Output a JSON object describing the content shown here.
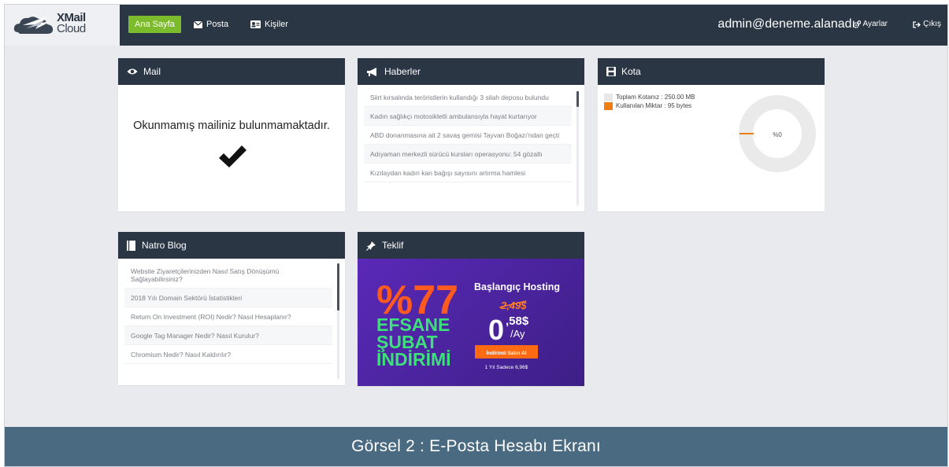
{
  "app": {
    "logo_line1": "XMail",
    "logo_line2": "Cloud"
  },
  "nav": {
    "home": "Ana Sayfa",
    "posta": "Posta",
    "kisiler": "Kişiler",
    "user_email": "admin@deneme.alanadı",
    "settings": "Ayarlar",
    "logout": "Çıkış"
  },
  "panels": {
    "mail": {
      "title": "Mail",
      "message": "Okunmamış mailiniz bulunmamaktadır.",
      "icon": "eye-icon",
      "status_icon": "checkmark-icon"
    },
    "haberler": {
      "title": "Haberler",
      "icon": "megaphone-icon",
      "items": [
        "Siirt kırsalında teröristlerin kullandığı 3 silah deposu bulundu",
        "Kadın sağlıkçı motosikletli ambulansıyla hayat kurtarıyor",
        "ABD donanmasına ait 2 savaş gemisi Tayvan Boğazı'ndan geçti",
        "Adıyaman merkezli sürücü kursları operasyonu: 54 gözaltı",
        "Kızılaydan kadın kan bağışı sayısını artırma hamlesi"
      ]
    },
    "kota": {
      "title": "Kota",
      "icon": "save-icon",
      "total_label": "Toplam Kotanız : 250.00 MB",
      "used_label": "Kullanılan Miktar : 95 bytes",
      "percent_label": "%0",
      "used_fraction": 0.0,
      "colors": {
        "total": "#e8e8e8",
        "used": "#f07d12"
      }
    },
    "blog": {
      "title": "Natro Blog",
      "icon": "book-icon",
      "items": [
        "Website Ziyaretçilerinizden Nasıl Satış Dönüşümü Sağlayabilirsiniz?",
        "2018 Yılı Domain Sektörü İstatistikleri",
        "Return On Investment (ROI) Nedir? Nasıl Hesaplanır?",
        "Google Tag Manager Nedir? Nasıl Kurulur?",
        "Chromium Nedir? Nasıl Kaldırılır?"
      ]
    },
    "teklif": {
      "title": "Teklif",
      "icon": "pin-icon",
      "promo": {
        "percent": "%77",
        "line1": "EFSANE",
        "line2": "ŞUBAT",
        "line3": "İNDİRİMİ",
        "heading": "Başlangıç Hosting",
        "old_price": "2,49$",
        "new_price_int": "0",
        "new_price_dec": ",58$",
        "per": "/Ay",
        "button": "İndirimli Satın Al",
        "footnote": "1 Yıl Sadece 6,96$"
      }
    }
  },
  "caption": "Görsel 2 : E-Posta Hesabı Ekranı",
  "colors": {
    "topbar": "#2a3644",
    "accent_green": "#7cbb2b",
    "caption_bg": "#4a6a82",
    "promo_purple": "#4a23a0",
    "promo_orange": "#ff6a13"
  }
}
